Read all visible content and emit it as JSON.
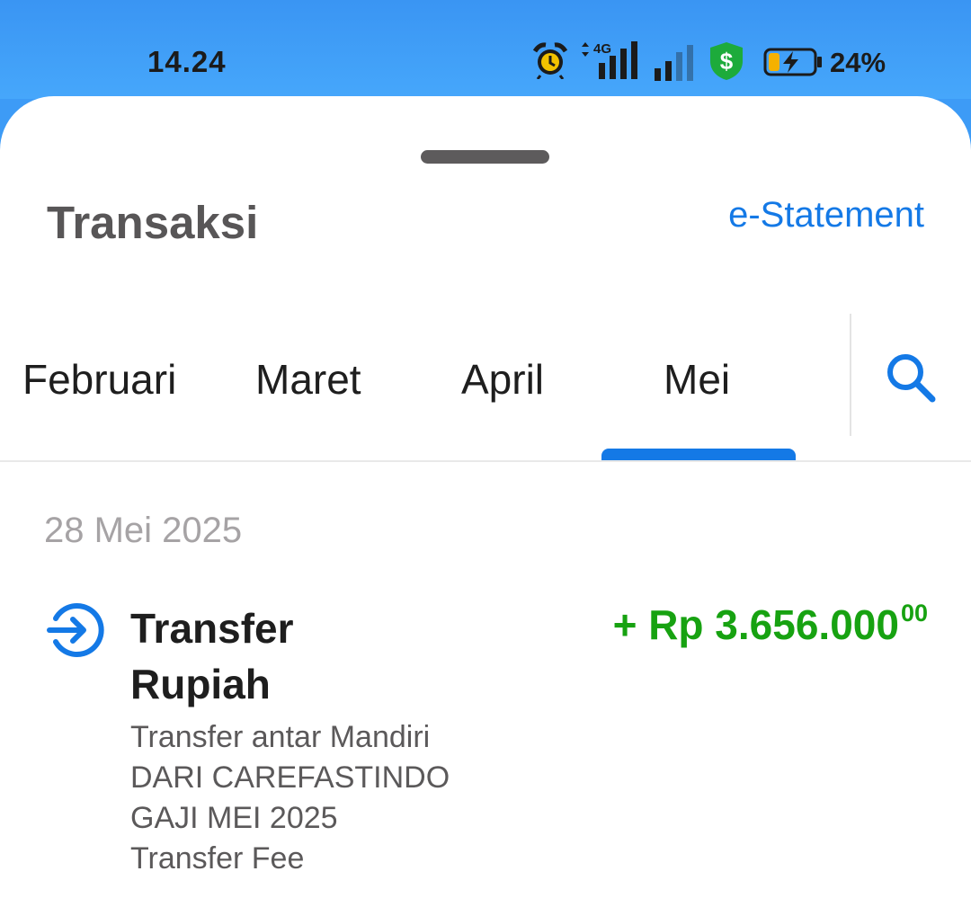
{
  "status_bar": {
    "time": "14.24",
    "network_label": "4G",
    "battery_percent": "24%",
    "icons": [
      "alarm-icon",
      "signal-4g-icon",
      "signal-icon",
      "security-shield-icon",
      "battery-charging-icon"
    ],
    "shield_color": "#1dab3b",
    "battery_level": 0.24
  },
  "header": {
    "title": "Transaksi",
    "estatement_label": "e-Statement"
  },
  "tabs": {
    "items": [
      {
        "label": "Februari"
      },
      {
        "label": "Maret"
      },
      {
        "label": "April"
      },
      {
        "label": "Mei",
        "selected": true
      }
    ],
    "search_icon": "search-icon"
  },
  "transactions": {
    "date": "28 Mei 2025",
    "items": [
      {
        "icon": "transfer-in-icon",
        "title": "Transfer Rupiah",
        "desc_lines": [
          "Transfer antar Mandiri",
          "DARI CAREFASTINDO",
          "GAJI MEI 2025",
          "Transfer Fee"
        ],
        "amount_main": "+ Rp 3.656.000",
        "amount_cents": "00",
        "amount_color": "#17a211"
      }
    ]
  },
  "colors": {
    "accent": "#1479e6",
    "status_bar_bg": "#3d9bf6",
    "positive": "#17a211"
  }
}
